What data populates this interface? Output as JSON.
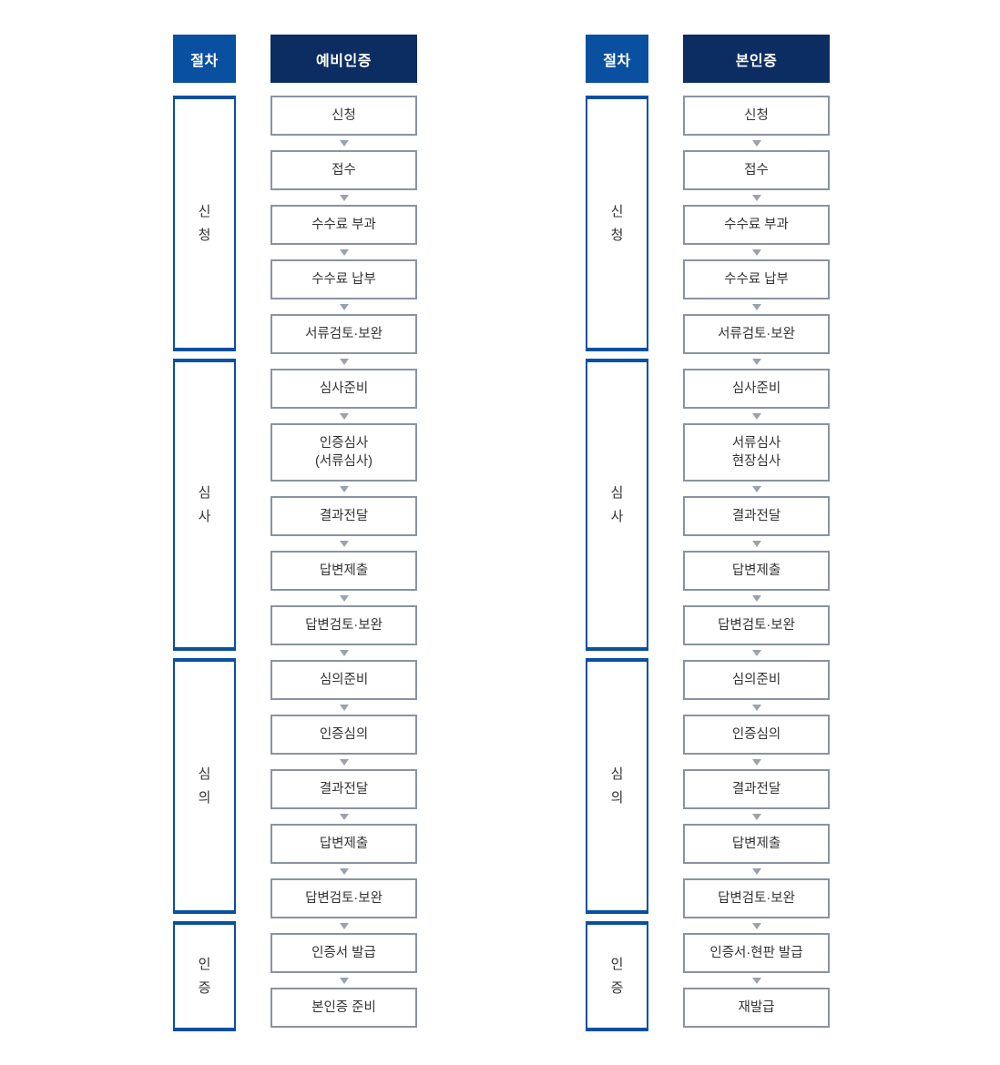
{
  "colors": {
    "stage_header_bg": "#0A50A0",
    "proc_header_bg": "#0C2D62",
    "stage_box_border": "#0A50A0",
    "proc_box_border": "#8A93A0",
    "arrow": "#9AA2AE",
    "text": "#333333",
    "header_text": "#FFFFFF",
    "page_bg": "#FFFFFF"
  },
  "icons": {
    "arrow": "chevron-down-icon"
  },
  "groups": [
    {
      "id": "preliminary-certification",
      "stage_header": "절차",
      "process_header": "예비인증",
      "stages": [
        {
          "id": "application",
          "label": "신\n청",
          "steps": [
            {
              "label": "신청",
              "lines": 1
            },
            {
              "label": "접수",
              "lines": 1
            },
            {
              "label": "수수료 부과",
              "lines": 1
            },
            {
              "label": "수수료 납부",
              "lines": 1
            },
            {
              "label": "서류검토·보완",
              "lines": 1
            }
          ]
        },
        {
          "id": "examination",
          "label": "심\n사",
          "steps": [
            {
              "label": "심사준비",
              "lines": 1
            },
            {
              "label": "인증심사\n(서류심사)",
              "lines": 2
            },
            {
              "label": "결과전달",
              "lines": 1
            },
            {
              "label": "답변제출",
              "lines": 1
            },
            {
              "label": "답변검토·보완",
              "lines": 1
            }
          ]
        },
        {
          "id": "deliberation",
          "label": "심\n의",
          "steps": [
            {
              "label": "심의준비",
              "lines": 1
            },
            {
              "label": "인증심의",
              "lines": 1
            },
            {
              "label": "결과전달",
              "lines": 1
            },
            {
              "label": "답변제출",
              "lines": 1
            },
            {
              "label": "답변검토·보완",
              "lines": 1
            }
          ]
        },
        {
          "id": "certification",
          "label": "인\n증",
          "steps": [
            {
              "label": "인증서 발급",
              "lines": 1
            },
            {
              "label": "본인증 준비",
              "lines": 1
            }
          ]
        }
      ]
    },
    {
      "id": "main-certification",
      "stage_header": "절차",
      "process_header": "본인증",
      "stages": [
        {
          "id": "application",
          "label": "신\n청",
          "steps": [
            {
              "label": "신청",
              "lines": 1
            },
            {
              "label": "접수",
              "lines": 1
            },
            {
              "label": "수수료 부과",
              "lines": 1
            },
            {
              "label": "수수료 납부",
              "lines": 1
            },
            {
              "label": "서류검토·보완",
              "lines": 1
            }
          ]
        },
        {
          "id": "examination",
          "label": "심\n사",
          "steps": [
            {
              "label": "심사준비",
              "lines": 1
            },
            {
              "label": "서류심사\n현장심사",
              "lines": 2
            },
            {
              "label": "결과전달",
              "lines": 1
            },
            {
              "label": "답변제출",
              "lines": 1
            },
            {
              "label": "답변검토·보완",
              "lines": 1
            }
          ]
        },
        {
          "id": "deliberation",
          "label": "심\n의",
          "steps": [
            {
              "label": "심의준비",
              "lines": 1
            },
            {
              "label": "인증심의",
              "lines": 1
            },
            {
              "label": "결과전달",
              "lines": 1
            },
            {
              "label": "답변제출",
              "lines": 1
            },
            {
              "label": "답변검토·보완",
              "lines": 1
            }
          ]
        },
        {
          "id": "certification",
          "label": "인\n증",
          "steps": [
            {
              "label": "인증서·현판 발급",
              "lines": 1
            },
            {
              "label": "재발급",
              "lines": 1
            }
          ]
        }
      ]
    }
  ]
}
